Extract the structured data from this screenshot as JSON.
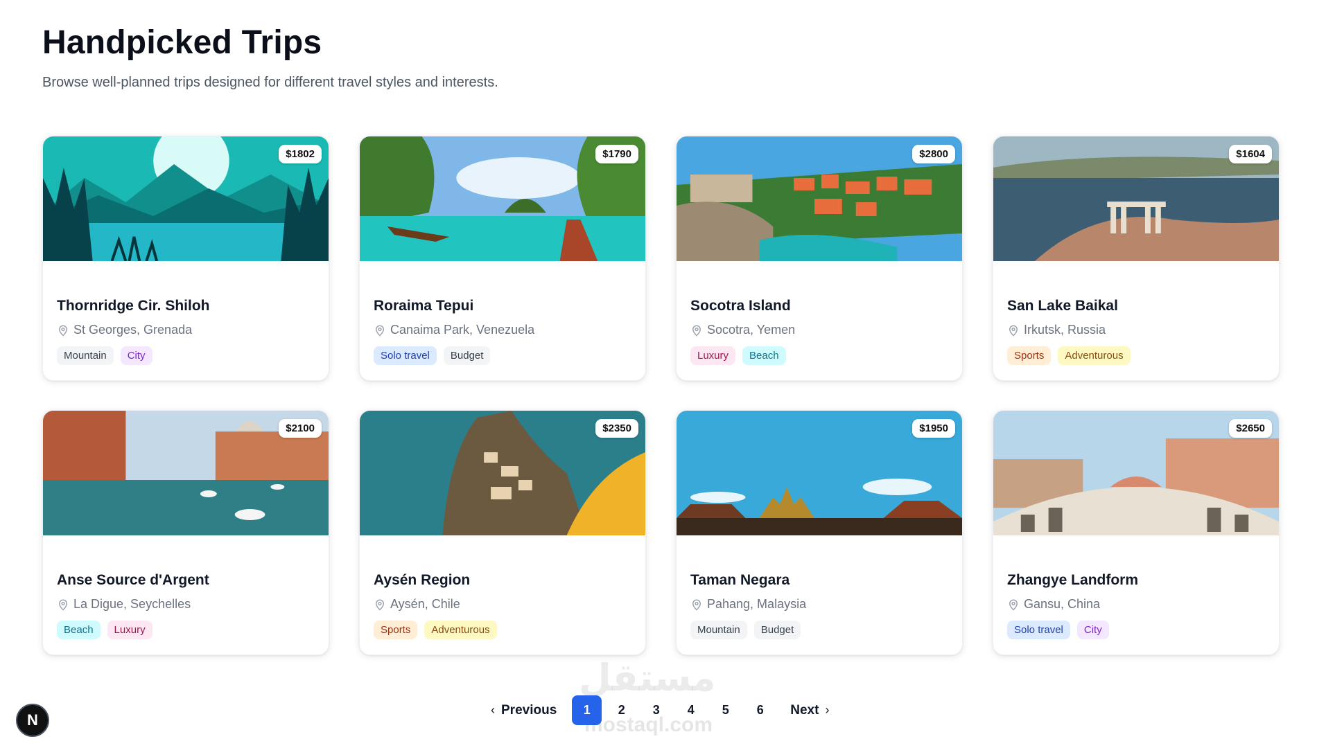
{
  "header": {
    "title": "Handpicked Trips",
    "subtitle": "Browse well-planned trips designed for different travel styles and interests."
  },
  "tag_colors": {
    "Mountain": {
      "bg": "#f3f4f6",
      "fg": "#374151"
    },
    "City": {
      "bg": "#f3e8ff",
      "fg": "#7e22ce"
    },
    "Solo travel": {
      "bg": "#dbeafe",
      "fg": "#1e40af"
    },
    "Budget": {
      "bg": "#f3f4f6",
      "fg": "#374151"
    },
    "Luxury": {
      "bg": "#fce7f3",
      "fg": "#9d174d"
    },
    "Beach": {
      "bg": "#cffafe",
      "fg": "#0e7490"
    },
    "Sports": {
      "bg": "#ffedd5",
      "fg": "#9a3412"
    },
    "Adventurous": {
      "bg": "#fef9c3",
      "fg": "#854d0e"
    }
  },
  "trips": [
    {
      "title": "Thornridge Cir. Shiloh",
      "location": "St Georges, Grenada",
      "price": "$1802",
      "tags": [
        "Mountain",
        "City"
      ],
      "image": "mountain-lake-illustration"
    },
    {
      "title": "Roraima Tepui",
      "location": "Canaima Park, Venezuela",
      "price": "$1790",
      "tags": [
        "Solo travel",
        "Budget"
      ],
      "image": "tropical-cliffs-boats"
    },
    {
      "title": "Socotra Island",
      "location": "Socotra, Yemen",
      "price": "$2800",
      "tags": [
        "Luxury",
        "Beach"
      ],
      "image": "coastal-old-town"
    },
    {
      "title": "San Lake Baikal",
      "location": "Irkutsk, Russia",
      "price": "$1604",
      "tags": [
        "Sports",
        "Adventurous"
      ],
      "image": "temple-ruins-coast"
    },
    {
      "title": "Anse Source d'Argent",
      "location": "La Digue, Seychelles",
      "price": "$2100",
      "tags": [
        "Beach",
        "Luxury"
      ],
      "image": "venice-canal"
    },
    {
      "title": "Aysén Region",
      "location": "Aysén, Chile",
      "price": "$2350",
      "tags": [
        "Sports",
        "Adventurous"
      ],
      "image": "cliff-village-sea"
    },
    {
      "title": "Taman Negara",
      "location": "Pahang, Malaysia",
      "price": "$1950",
      "tags": [
        "Mountain",
        "Budget"
      ],
      "image": "temple-roofs-sky"
    },
    {
      "title": "Zhangye Landform",
      "location": "Gansu, China",
      "price": "$2650",
      "tags": [
        "Solo travel",
        "City"
      ],
      "image": "rialto-bridge"
    }
  ],
  "pagination": {
    "previous_label": "Previous",
    "next_label": "Next",
    "pages": [
      "1",
      "2",
      "3",
      "4",
      "5",
      "6"
    ],
    "current_page": "1"
  },
  "watermark": {
    "text": "مستقل",
    "sub": "mostaql.com"
  },
  "next_badge": {
    "label": "N"
  }
}
